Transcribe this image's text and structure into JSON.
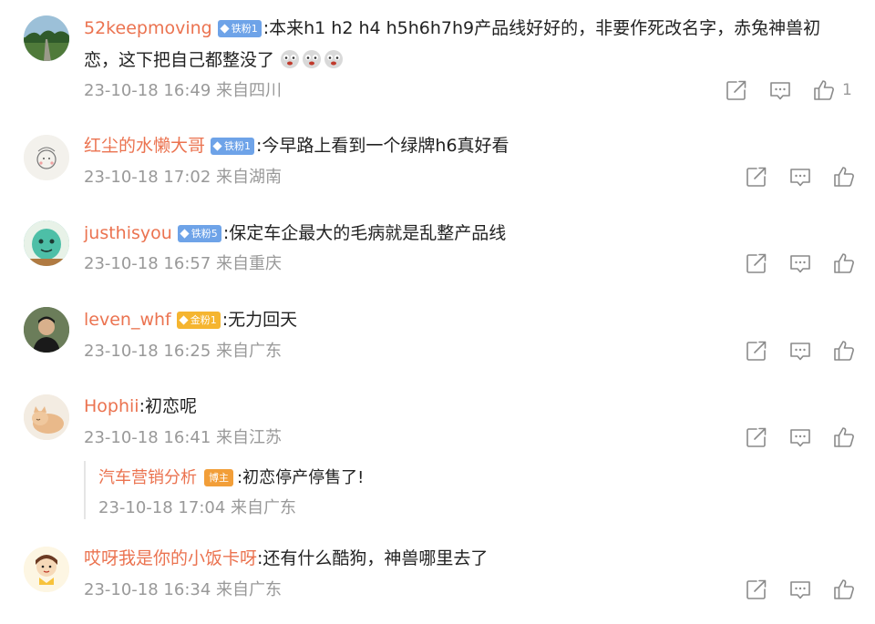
{
  "comments": [
    {
      "user": "52keepmoving",
      "badge": "铁粉1",
      "text_line1": ":本来h1 h2  h4 h5h6h7h9产品线好好的，非要作死改名字，赤兔神兽初",
      "text_line2": "恋，这下把自己都整没了",
      "emoji_count": 3,
      "meta": "23-10-18 16:49 来自四川",
      "like_count": "1"
    },
    {
      "user": "红尘的水懒大哥",
      "badge": "铁粉1",
      "text": ":今早路上看到一个绿牌h6真好看",
      "meta": "23-10-18 17:02 来自湖南"
    },
    {
      "user": "justhisyou",
      "badge": "铁粉5",
      "text": ":保定车企最大的毛病就是乱整产品线",
      "meta": "23-10-18 16:57 来自重庆"
    },
    {
      "user": "leven_whf",
      "badge": "金粉1",
      "text": ":无力回天",
      "meta": "23-10-18 16:25 来自广东"
    },
    {
      "user": "Hophii",
      "text": ":初恋呢",
      "meta": "23-10-18 16:41 来自江苏",
      "reply": {
        "user": "汽车营销分析",
        "badge": "博主",
        "text": ":初恋停产停售了!",
        "meta": "23-10-18 17:04 来自广东"
      }
    },
    {
      "user": "哎呀我是你的小饭卡呀",
      "text": ":还有什么酷狗，神兽哪里去了",
      "meta": "23-10-18 16:34 来自广东"
    }
  ],
  "colors": {
    "username": "#eb7350",
    "meta": "#999999",
    "badge_iron": "#6ea3e8",
    "badge_gold": "#f5b530",
    "badge_host": "#f29e38"
  }
}
